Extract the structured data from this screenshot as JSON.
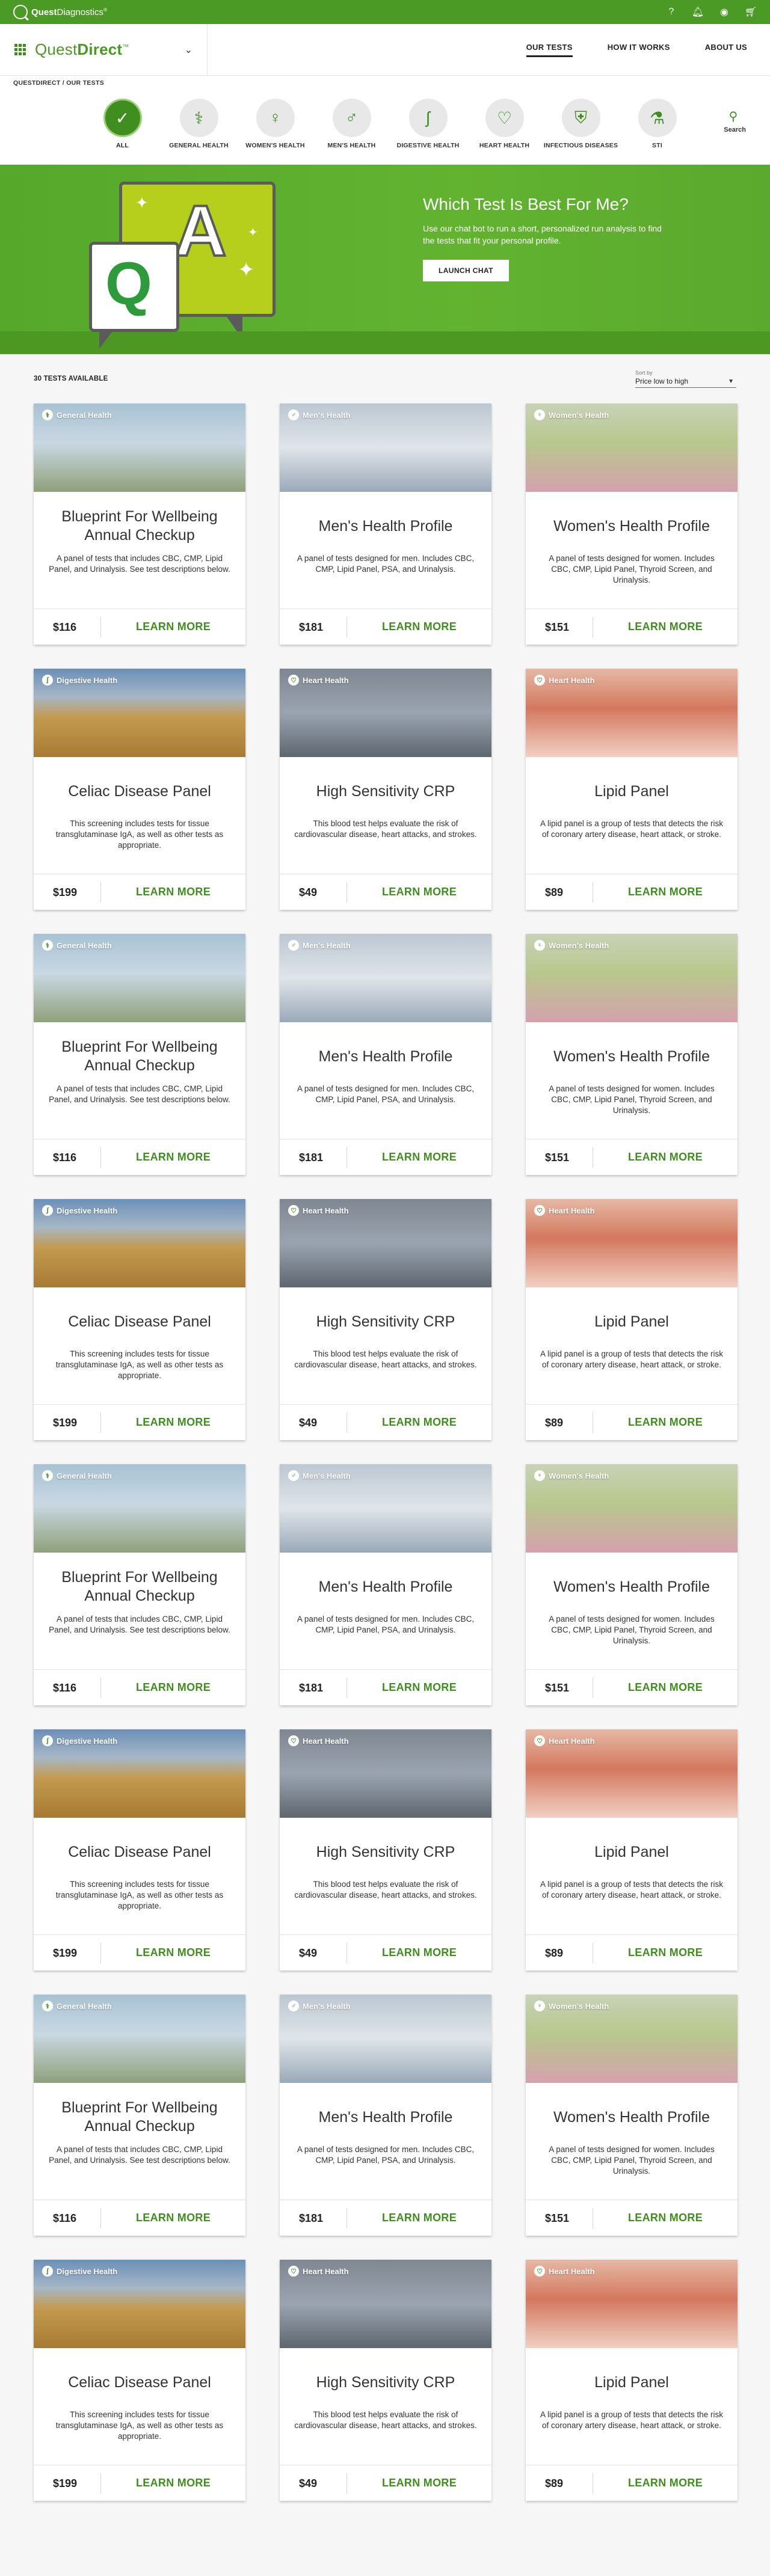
{
  "brand": {
    "name_bold": "Quest",
    "name_rest": "Diagnostics",
    "mark": "®"
  },
  "utility_icons": [
    "help-icon",
    "bell-icon",
    "account-icon",
    "cart-icon"
  ],
  "app": {
    "title_light": "Quest",
    "title_bold": "Direct",
    "tm": "™"
  },
  "nav": {
    "our_tests": "OUR TESTS",
    "how_it_works": "HOW IT WORKS",
    "about_us": "ABOUT US"
  },
  "breadcrumb": "QUESTDIRECT / OUR TESTS",
  "categories": [
    {
      "label": "ALL",
      "icon": "✓"
    },
    {
      "label": "GENERAL HEALTH",
      "icon": "⚕"
    },
    {
      "label": "WOMEN'S HEALTH",
      "icon": "♀"
    },
    {
      "label": "MEN'S HEALTH",
      "icon": "♂"
    },
    {
      "label": "DIGESTIVE HEALTH",
      "icon": "ʃ"
    },
    {
      "label": "HEART HEALTH",
      "icon": "♡"
    },
    {
      "label": "INFECTIOUS DISEASES",
      "icon": "⛨"
    },
    {
      "label": "STI",
      "icon": "⚗"
    }
  ],
  "search_label": "Search",
  "hero": {
    "title": "Which Test Is Best For Me?",
    "text": "Use our chat bot to run a short, personalized run analysis to find the tests that fit your personal profile.",
    "button": "LAUNCH CHAT",
    "q_letter": "Q",
    "a_letter": "A"
  },
  "results": {
    "count": "30 TESTS AVAILABLE",
    "sort_label": "Sort by",
    "sort_value": "Price low to high"
  },
  "cta": "LEARN MORE",
  "products": [
    {
      "category": "General Health",
      "title": "Blueprint For Wellbeing Annual Checkup",
      "desc": "A panel of tests that includes CBC, CMP, Lipid Panel, and Urinalysis. See test descriptions below.",
      "price": "$116"
    },
    {
      "category": "Men's Health",
      "title": "Men's Health Profile",
      "desc": "A panel of tests designed for men. Includes CBC, CMP, Lipid Panel, PSA, and Urinalysis.",
      "price": "$181"
    },
    {
      "category": "Women's Health",
      "title": "Women's Health Profile",
      "desc": "A panel of tests designed for women. Includes CBC, CMP, Lipid Panel, Thyroid Screen, and Urinalysis.",
      "price": "$151"
    },
    {
      "category": "Digestive Health",
      "title": "Celiac Disease Panel",
      "desc": "This screening includes tests for tissue transglutaminase IgA, as well as other tests as appropriate.",
      "price": "$199"
    },
    {
      "category": "Heart Health",
      "title": "High Sensitivity CRP",
      "desc": "This blood test helps evaluate the risk of cardiovascular disease, heart attacks, and strokes.",
      "price": "$49"
    },
    {
      "category": "Heart Health",
      "title": "Lipid Panel",
      "desc": "A lipid panel is a group of tests that detects the risk of coronary artery disease, heart attack, or stroke.",
      "price": "$89"
    },
    {
      "category": "General Health",
      "title": "Blueprint For Wellbeing Annual Checkup",
      "desc": "A panel of tests that includes CBC, CMP, Lipid Panel, and Urinalysis. See test descriptions below.",
      "price": "$116"
    },
    {
      "category": "Men's Health",
      "title": "Men's Health Profile",
      "desc": "A panel of tests designed for men. Includes CBC, CMP, Lipid Panel, PSA, and Urinalysis.",
      "price": "$181"
    },
    {
      "category": "Women's Health",
      "title": "Women's Health Profile",
      "desc": "A panel of tests designed for women. Includes CBC, CMP, Lipid Panel, Thyroid Screen, and Urinalysis.",
      "price": "$151"
    },
    {
      "category": "Digestive Health",
      "title": "Celiac Disease Panel",
      "desc": "This screening includes tests for tissue transglutaminase IgA, as well as other tests as appropriate.",
      "price": "$199"
    },
    {
      "category": "Heart Health",
      "title": "High Sensitivity CRP",
      "desc": "This blood test helps evaluate the risk of cardiovascular disease, heart attacks, and strokes.",
      "price": "$49"
    },
    {
      "category": "Heart Health",
      "title": "Lipid Panel",
      "desc": "A lipid panel is a group of tests that detects the risk of coronary artery disease, heart attack, or stroke.",
      "price": "$89"
    },
    {
      "category": "General Health",
      "title": "Blueprint For Wellbeing Annual Checkup",
      "desc": "A panel of tests that includes CBC, CMP, Lipid Panel, and Urinalysis. See test descriptions below.",
      "price": "$116"
    },
    {
      "category": "Men's Health",
      "title": "Men's Health Profile",
      "desc": "A panel of tests designed for men. Includes CBC, CMP, Lipid Panel, PSA, and Urinalysis.",
      "price": "$181"
    },
    {
      "category": "Women's Health",
      "title": "Women's Health Profile",
      "desc": "A panel of tests designed for women. Includes CBC, CMP, Lipid Panel, Thyroid Screen, and Urinalysis.",
      "price": "$151"
    },
    {
      "category": "Digestive Health",
      "title": "Celiac Disease Panel",
      "desc": "This screening includes tests for tissue transglutaminase IgA, as well as other tests as appropriate.",
      "price": "$199"
    },
    {
      "category": "Heart Health",
      "title": "High Sensitivity CRP",
      "desc": "This blood test helps evaluate the risk of cardiovascular disease, heart attacks, and strokes.",
      "price": "$49"
    },
    {
      "category": "Heart Health",
      "title": "Lipid Panel",
      "desc": "A lipid panel is a group of tests that detects the risk of coronary artery disease, heart attack, or stroke.",
      "price": "$89"
    },
    {
      "category": "General Health",
      "title": "Blueprint For Wellbeing Annual Checkup",
      "desc": "A panel of tests that includes CBC, CMP, Lipid Panel, and Urinalysis. See test descriptions below.",
      "price": "$116"
    },
    {
      "category": "Men's Health",
      "title": "Men's Health Profile",
      "desc": "A panel of tests designed for men. Includes CBC, CMP, Lipid Panel, PSA, and Urinalysis.",
      "price": "$181"
    },
    {
      "category": "Women's Health",
      "title": "Women's Health Profile",
      "desc": "A panel of tests designed for women. Includes CBC, CMP, Lipid Panel, Thyroid Screen, and Urinalysis.",
      "price": "$151"
    },
    {
      "category": "Digestive Health",
      "title": "Celiac Disease Panel",
      "desc": "This screening includes tests for tissue transglutaminase IgA, as well as other tests as appropriate.",
      "price": "$199"
    },
    {
      "category": "Heart Health",
      "title": "High Sensitivity CRP",
      "desc": "This blood test helps evaluate the risk of cardiovascular disease, heart attacks, and strokes.",
      "price": "$49"
    },
    {
      "category": "Heart Health",
      "title": "Lipid Panel",
      "desc": "A lipid panel is a group of tests that detects the risk of coronary artery disease, heart attack, or stroke.",
      "price": "$89"
    }
  ],
  "colors": {
    "brand_green": "#4a9a25",
    "accent_green": "#3f8e1f",
    "hero_green": "#5ba92e"
  }
}
